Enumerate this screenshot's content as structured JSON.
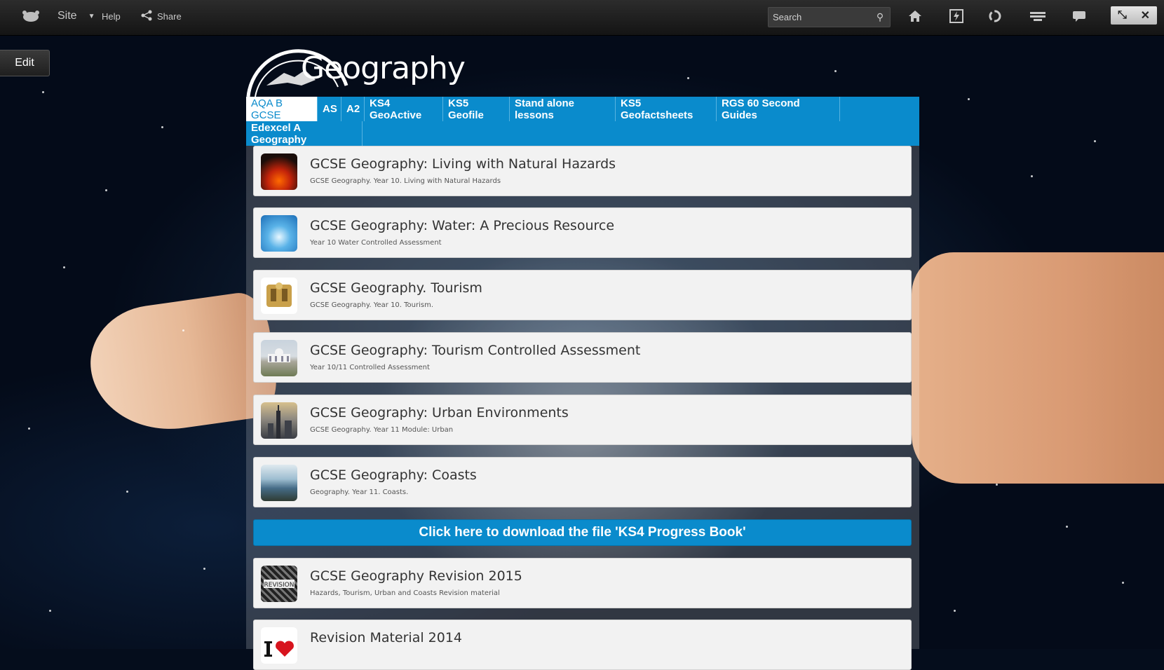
{
  "topbar": {
    "site_label": "Site",
    "help_label": "Help",
    "share_label": "Share",
    "search_placeholder": "Search"
  },
  "edit_label": "Edit",
  "site_title": "Geography",
  "nav": {
    "tabs": [
      {
        "label": "AQA B GCSE",
        "active": true
      },
      {
        "label": "AS"
      },
      {
        "label": "A2"
      },
      {
        "label": "KS4 GeoActive"
      },
      {
        "label": "KS5 Geofile"
      },
      {
        "label": "Stand alone lessons"
      },
      {
        "label": "KS5 Geofactsheets"
      },
      {
        "label": "RGS 60 Second Guides"
      },
      {
        "label": "Edexcel A Geography"
      }
    ]
  },
  "cards": [
    {
      "title": "GCSE Geography: Living with Natural Hazards",
      "subtitle": "GCSE Geography. Year 10. Living with Natural Hazards",
      "thumb": "volcano-thumbnail"
    },
    {
      "title": "GCSE Geography: Water: A Precious Resource",
      "subtitle": "Year 10 Water Controlled Assessment",
      "thumb": "water-splash-thumbnail"
    },
    {
      "title": "GCSE Geography. Tourism",
      "subtitle": "GCSE Geography. Year 10. Tourism.",
      "thumb": "tourism-thumbnail"
    },
    {
      "title": "GCSE Geography: Tourism Controlled Assessment",
      "subtitle": "Year 10/11 Controlled Assessment",
      "thumb": "building-thumbnail"
    },
    {
      "title": "GCSE Geography: Urban Environments",
      "subtitle": "GCSE Geography. Year 11 Module: Urban",
      "thumb": "city-skyline-thumbnail"
    },
    {
      "title": "GCSE Geography: Coasts",
      "subtitle": "Geography. Year 11. Coasts.",
      "thumb": "coast-thumbnail"
    }
  ],
  "download_label": "Click here to download the file 'KS4 Progress Book'",
  "cards_after": [
    {
      "title": "GCSE Geography Revision 2015",
      "subtitle": "Hazards, Tourism, Urban and Coasts Revision material",
      "thumb": "revision-thumbnail"
    },
    {
      "title": "Revision Material 2014",
      "subtitle": "",
      "thumb": "i-love-thumbnail"
    }
  ],
  "colors": {
    "accent": "#0a8bcc",
    "topbar": "#1e1e1e",
    "card_bg": "#f2f2f2"
  }
}
